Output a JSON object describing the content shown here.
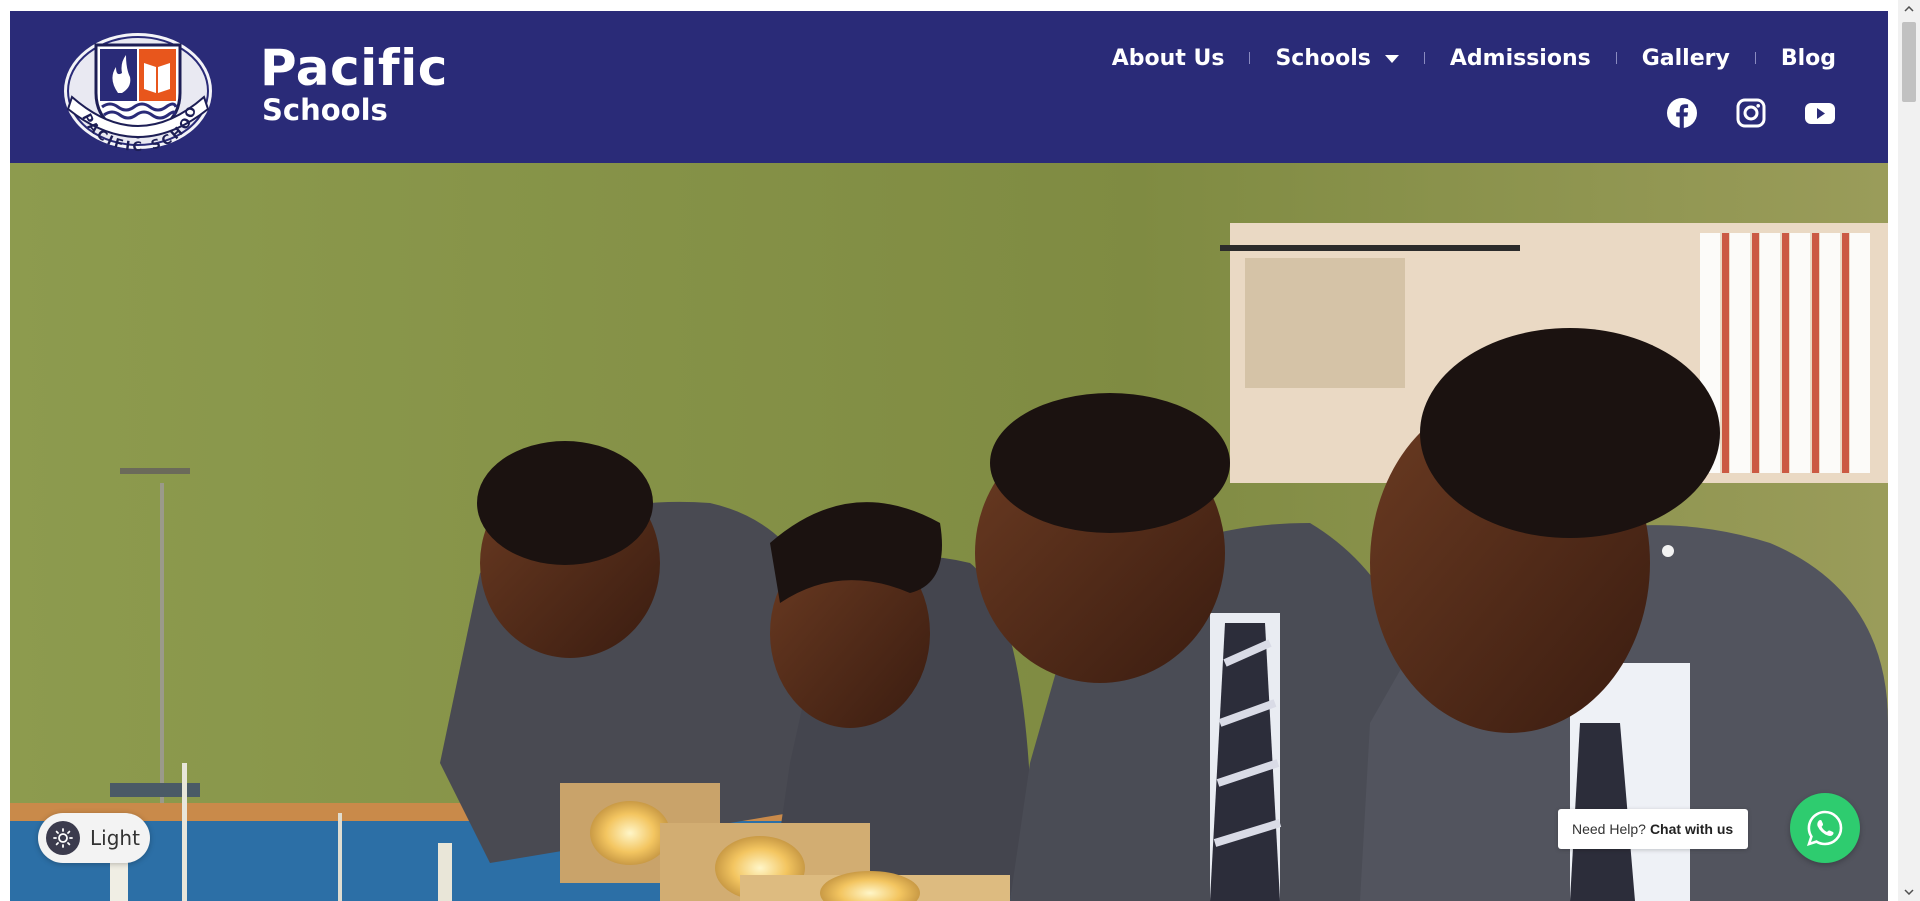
{
  "brand": {
    "name": "Pacific",
    "sub": "Schools",
    "logo_text": "PACIFIC SCHOOLS"
  },
  "nav": {
    "items": [
      {
        "label": "About Us"
      },
      {
        "label": "Schools"
      },
      {
        "label": "Admissions"
      },
      {
        "label": "Gallery"
      },
      {
        "label": "Blog"
      }
    ]
  },
  "social": [
    "facebook-icon",
    "instagram-icon",
    "youtube-icon"
  ],
  "theme_toggle": {
    "label": "Light"
  },
  "chat": {
    "prefix": "Need Help?",
    "cta": "Chat with us"
  },
  "colors": {
    "header_bg": "#2a2b78",
    "whatsapp": "#2ecc6f",
    "text_on_header": "#ffffff"
  }
}
